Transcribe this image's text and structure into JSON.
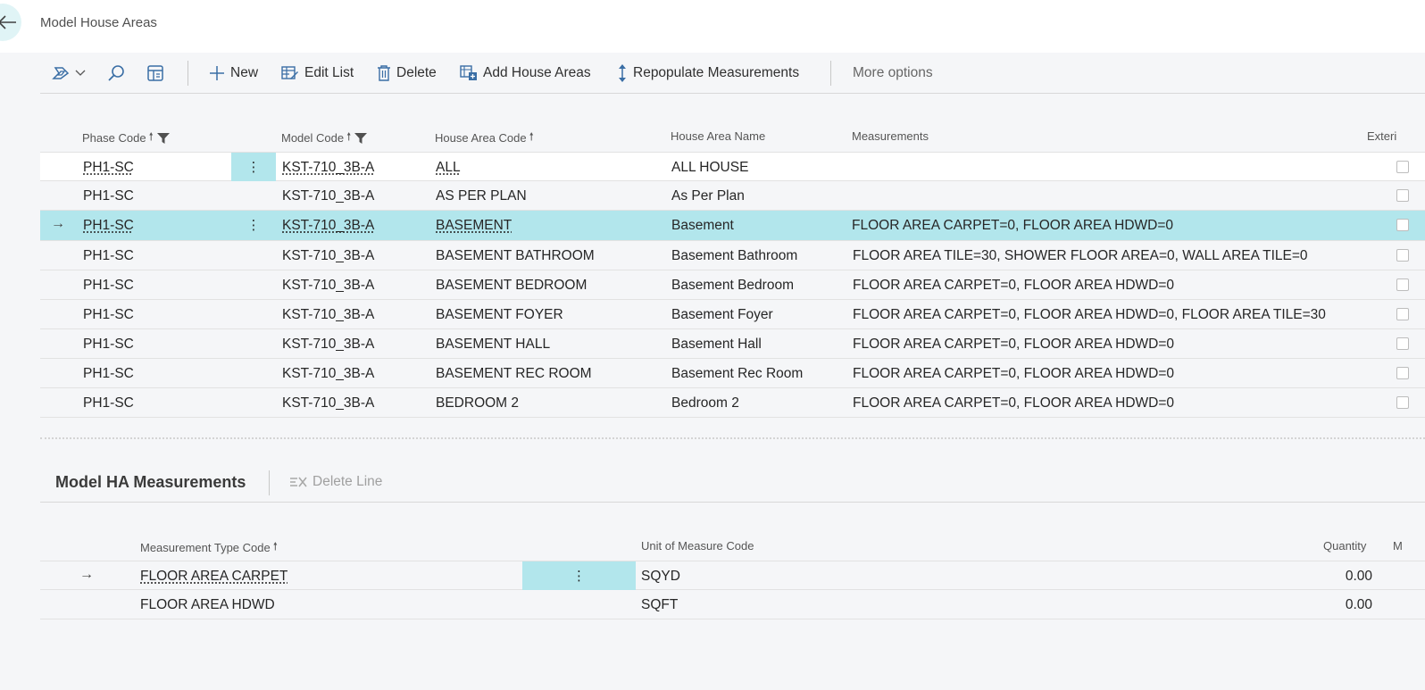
{
  "header": {
    "title": "Model House Areas"
  },
  "toolbar": {
    "new_label": "New",
    "edit_list_label": "Edit List",
    "delete_label": "Delete",
    "add_house_areas_label": "Add House Areas",
    "repopulate_label": "Repopulate Measurements",
    "more_label": "More options"
  },
  "grid": {
    "columns": {
      "phase_code": "Phase Code",
      "model_code": "Model Code",
      "house_area_code": "House Area Code",
      "house_area_name": "House Area Name",
      "measurements": "Measurements",
      "exterior": "Exteri"
    },
    "rows": [
      {
        "phase": "PH1-SC",
        "model": "KST-710_3B-A",
        "code": "ALL",
        "name": "ALL HOUSE",
        "measurements": ""
      },
      {
        "phase": "PH1-SC",
        "model": "KST-710_3B-A",
        "code": "AS PER PLAN",
        "name": "As Per Plan",
        "measurements": ""
      },
      {
        "phase": "PH1-SC",
        "model": "KST-710_3B-A",
        "code": "BASEMENT",
        "name": "Basement",
        "measurements": "FLOOR AREA CARPET=0, FLOOR AREA HDWD=0"
      },
      {
        "phase": "PH1-SC",
        "model": "KST-710_3B-A",
        "code": "BASEMENT BATHROOM",
        "name": "Basement Bathroom",
        "measurements": "FLOOR AREA TILE=30, SHOWER FLOOR AREA=0, WALL AREA TILE=0"
      },
      {
        "phase": "PH1-SC",
        "model": "KST-710_3B-A",
        "code": "BASEMENT BEDROOM",
        "name": "Basement Bedroom",
        "measurements": "FLOOR AREA CARPET=0, FLOOR AREA HDWD=0"
      },
      {
        "phase": "PH1-SC",
        "model": "KST-710_3B-A",
        "code": "BASEMENT FOYER",
        "name": "Basement Foyer",
        "measurements": "FLOOR AREA CARPET=0, FLOOR AREA HDWD=0, FLOOR AREA TILE=30"
      },
      {
        "phase": "PH1-SC",
        "model": "KST-710_3B-A",
        "code": "BASEMENT HALL",
        "name": "Basement Hall",
        "measurements": "FLOOR AREA CARPET=0, FLOOR AREA HDWD=0"
      },
      {
        "phase": "PH1-SC",
        "model": "KST-710_3B-A",
        "code": "BASEMENT REC ROOM",
        "name": "Basement Rec Room",
        "measurements": "FLOOR AREA CARPET=0, FLOOR AREA HDWD=0"
      },
      {
        "phase": "PH1-SC",
        "model": "KST-710_3B-A",
        "code": "BEDROOM 2",
        "name": "Bedroom 2",
        "measurements": "FLOOR AREA CARPET=0, FLOOR AREA HDWD=0"
      }
    ]
  },
  "subpage": {
    "title": "Model HA Measurements",
    "delete_line_label": "Delete Line",
    "columns": {
      "type_code": "Measurement Type Code",
      "uom": "Unit of Measure Code",
      "quantity": "Quantity",
      "extra": "M"
    },
    "rows": [
      {
        "type_code": "FLOOR AREA CARPET",
        "uom": "SQYD",
        "quantity": "0.00"
      },
      {
        "type_code": "FLOOR AREA HDWD",
        "uom": "SQFT",
        "quantity": "0.00"
      }
    ]
  }
}
